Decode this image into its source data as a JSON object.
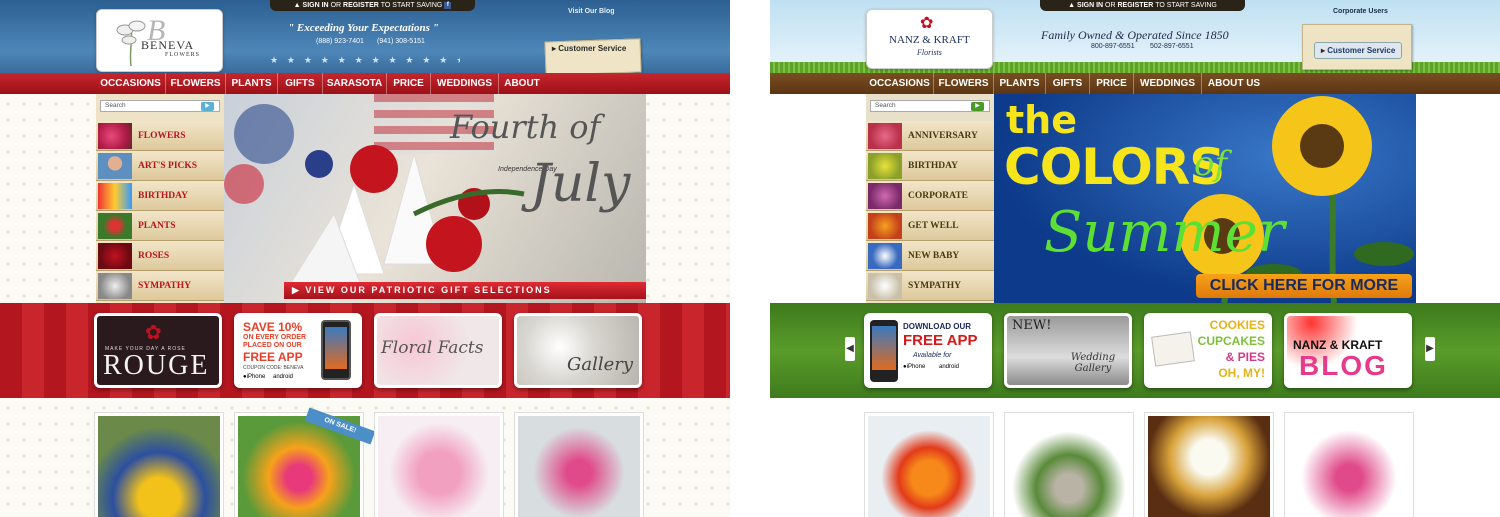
{
  "left": {
    "signin": {
      "sign_in": "SIGN IN",
      "or": "OR",
      "register": "REGISTER",
      "rest": "TO START SAVING",
      "fb": "f"
    },
    "logo": {
      "name": "BENEVA",
      "sub": "FLOWERS",
      "script": "B"
    },
    "tagline": "\" Exceeding Your Expectations \"",
    "phones": [
      "(888) 923-7401",
      "(941) 308-5151"
    ],
    "blog_link": "Visit Our Blog",
    "customer_service": "Customer Service",
    "nav": [
      "OCCASIONS",
      "FLOWERS",
      "PLANTS",
      "GIFTS",
      "SARASOTA",
      "PRICE",
      "WEDDINGS",
      "ABOUT"
    ],
    "search_placeholder": "Search",
    "sidebar": [
      "FLOWERS",
      "ART'S PICKS",
      "BIRTHDAY",
      "PLANTS",
      "ROSES",
      "SYMPATHY"
    ],
    "banner": {
      "title_1": "Fourth of",
      "title_2": "July",
      "small": "Independence Day",
      "cta": "VIEW OUR PATRIOTIC GIFT SELECTIONS"
    },
    "tiles": {
      "rouge": {
        "small": "MAKE YOUR DAY A ROSE",
        "big": "ROUGE"
      },
      "app": {
        "line1": "SAVE 10%",
        "line2": "ON EVERY ORDER",
        "line3": "PLACED ON OUR",
        "line4": "FREE APP",
        "code": "COUPON CODE: BENEVA",
        "iphone": "iPhone",
        "android": "android"
      },
      "facts": "Floral Facts",
      "gallery": "Gallery"
    },
    "on_sale": "ON SALE!",
    "colors": {
      "red": "#b8151d",
      "blue": "#2f6394"
    }
  },
  "right": {
    "signin": {
      "sign_in": "SIGN IN",
      "or": "OR",
      "register": "REGISTER",
      "rest": "TO START SAVING"
    },
    "logo": {
      "name": "NANZ & KRAFT",
      "sub": "Florists"
    },
    "tagline": "Family Owned & Operated Since 1850",
    "phones": [
      "800-897-6551",
      "502-897-6551"
    ],
    "corporate_link": "Corporate Users",
    "customer_service": "Customer Service",
    "nav": [
      "OCCASIONS",
      "FLOWERS",
      "PLANTS",
      "GIFTS",
      "PRICE",
      "WEDDINGS",
      "ABOUT US"
    ],
    "search_placeholder": "Search",
    "sidebar": [
      "ANNIVERSARY",
      "BIRTHDAY",
      "CORPORATE",
      "GET WELL",
      "NEW BABY",
      "SYMPATHY"
    ],
    "banner": {
      "the": "the",
      "colors": "COLORS",
      "of": "of",
      "summer": "Summer",
      "cta": "CLICK HERE FOR MORE"
    },
    "tiles": {
      "app": {
        "line1": "DOWNLOAD OUR",
        "line2": "FREE APP",
        "line3": "Available for",
        "iphone": "iPhone",
        "android": "android"
      },
      "wedding": {
        "new": "NEW!",
        "text": "Wedding Gallery"
      },
      "cookies": [
        "COOKIES",
        "CUPCAKES",
        "& PIES",
        "OH, MY!"
      ],
      "blog": {
        "top": "NANZ & KRAFT",
        "big": "BLOG"
      }
    },
    "colors": {
      "brown": "#6a4119",
      "green": "#4a8c24"
    }
  }
}
